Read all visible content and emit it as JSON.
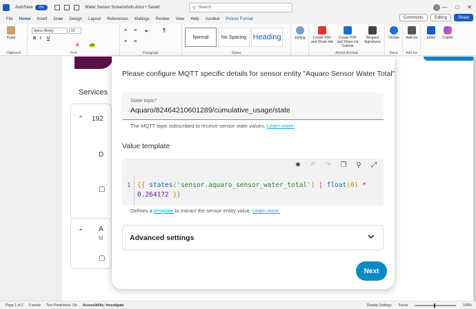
{
  "titlebar": {
    "autosave_label": "AutoSave",
    "autosave_state": "On",
    "doc_title": "Water Sensor Screenshots.docx • Saved",
    "search_placeholder": "Search"
  },
  "tabs": [
    {
      "label": "File"
    },
    {
      "label": "Home"
    },
    {
      "label": "Insert"
    },
    {
      "label": "Draw"
    },
    {
      "label": "Design"
    },
    {
      "label": "Layout"
    },
    {
      "label": "References"
    },
    {
      "label": "Mailings"
    },
    {
      "label": "Review"
    },
    {
      "label": "View"
    },
    {
      "label": "Help"
    },
    {
      "label": "Acrobat"
    },
    {
      "label": "Picture Format"
    }
  ],
  "tab_right": {
    "comments": "Comments",
    "editing": "Editing",
    "share": "Share"
  },
  "ribbon": {
    "paste_label": "Paste",
    "clipboard_label": "Clipboard",
    "font_name": "Aptos (Body)",
    "font_size": "12",
    "font_label": "Font",
    "paragraph_label": "Paragraph",
    "styles": [
      "Normal",
      "No Spacing",
      "Heading"
    ],
    "styles_label": "Styles",
    "editing_label": "Editing",
    "acrobat_btn1": "Create PDF and Share link",
    "acrobat_btn2": "Create PDF and Share via Outlook",
    "acrobat_btn3": "Request Signatures",
    "acrobat_label": "Adobe Acrobat",
    "dictate_label": "Dictate",
    "voice_label": "Voice",
    "addins_label": "Add-ins",
    "addins_group": "Add-ins",
    "editor_label": "Editor",
    "copilot_label": "Copilot"
  },
  "background": {
    "services_label": "Services",
    "row1": "192",
    "row2": "D",
    "row3": "A",
    "row3_sub": "M"
  },
  "dialog": {
    "intro": "Please configure MQTT specific details for sensor entity \"Aquaro Sensor Water Total\":",
    "state_topic_label": "State topic*",
    "state_topic_value": "Aquaro/82464210601289/cumulative_usage/state",
    "state_topic_help": "The MQTT topic subscribed to receive sensor state values.",
    "learn_more": "Learn more.",
    "value_template_title": "Value template",
    "code_line_number": "1",
    "code_part1": "{{ ",
    "code_fn": "states",
    "code_open": "(",
    "code_str": "'sensor.aquaro_sensor_water_total'",
    "code_close": ")",
    "code_pipe": " | ",
    "code_filter": "float",
    "code_arg": "(0)",
    "code_mul": "  *",
    "code_num": "0.264172",
    "code_end": " }}",
    "template_help_prefix": "Defines a",
    "template_link": "template",
    "template_help_suffix": "to extract the sensor entity value.",
    "advanced_settings": "Advanced settings",
    "next_button": "Next"
  },
  "statusbar": {
    "page": "Page 1 of 2",
    "words": "0 words",
    "text_predictions": "Text Predictions: On",
    "accessibility": "Accessibility: Investigate",
    "display_settings": "Display Settings",
    "focus": "Focus",
    "zoom": "100%"
  },
  "colors": {
    "word_blue": "#185abd",
    "ha_primary": "#03a9f4",
    "next_button": "#0b8ac6",
    "logo_purple": "#5b1146"
  }
}
